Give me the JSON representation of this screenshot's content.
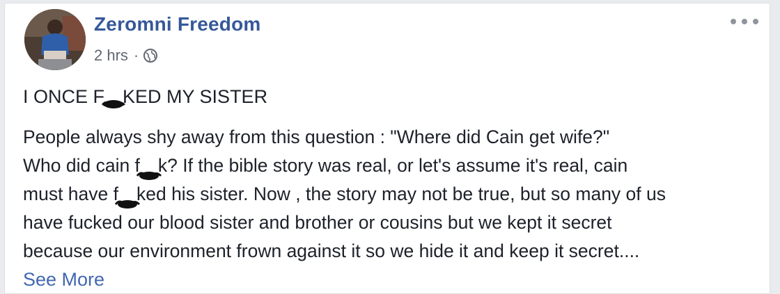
{
  "post": {
    "author_name": "Zeromni Freedom",
    "timestamp": "2 hrs",
    "separator": "·",
    "privacy_icon": "globe-icon",
    "options_icon": "more-options-icon",
    "headline": {
      "before": "I ONCE F",
      "after": "KED MY SISTER"
    },
    "body_lines": [
      {
        "text": "People always shy away from this question : \"Where did Cain get wife?\""
      },
      {
        "before": "Who did cain f",
        "after": "k? If the bible story was real, or let's assume it's real, cain"
      },
      {
        "before": "must have f",
        "after": "ked his sister. Now , the story may not be true, but so many of us"
      },
      {
        "text": "have fucked our blood sister and brother or cousins but we kept it secret"
      },
      {
        "text": "because our environment frown against it so we hide it and keep it secret...."
      }
    ],
    "see_more_label": "See More"
  },
  "colors": {
    "author": "#365899",
    "link": "#4267b2",
    "text": "#1d2129",
    "meta": "#616770"
  }
}
